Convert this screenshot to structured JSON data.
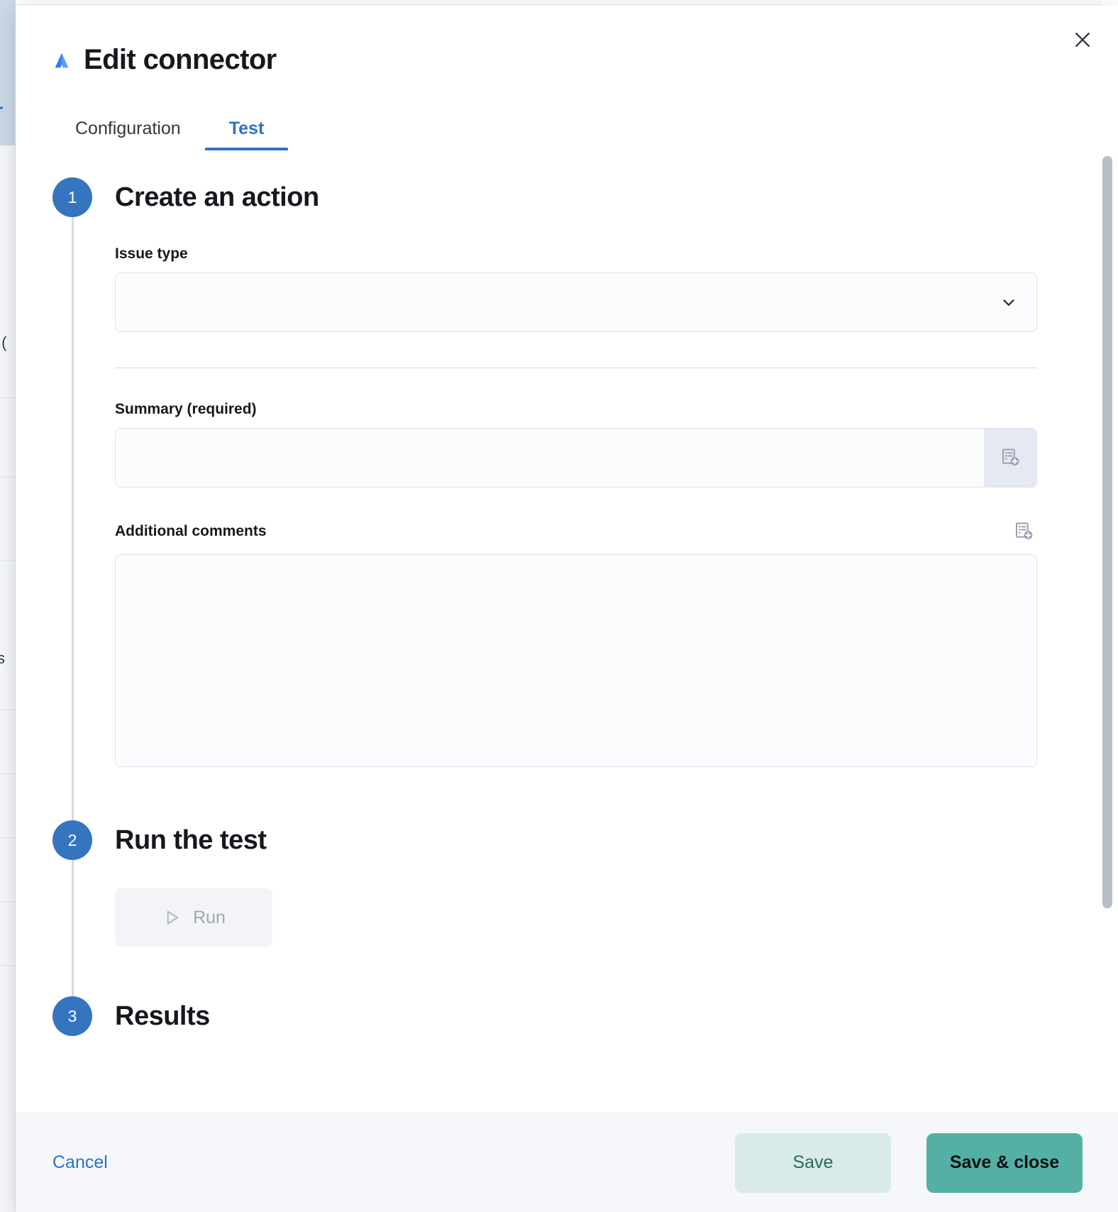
{
  "modal": {
    "title": "Edit connector",
    "brand_icon": "atlassian-jira-logo-icon",
    "close_icon": "close-icon",
    "accent_color": "#2e72c4",
    "tabs": [
      {
        "label": "Configuration",
        "active": false
      },
      {
        "label": "Test",
        "active": true
      }
    ]
  },
  "steps": [
    {
      "number": "1",
      "title": "Create an action"
    },
    {
      "number": "2",
      "title": "Run the test"
    },
    {
      "number": "3",
      "title": "Results"
    }
  ],
  "form": {
    "issue_type": {
      "label": "Issue type",
      "value": "",
      "placeholder": "",
      "chevron_icon": "chevron-down-icon"
    },
    "summary": {
      "label": "Summary (required)",
      "value": "",
      "placeholder": "",
      "append_icon": "add-variable-icon"
    },
    "additional_comments": {
      "label": "Additional comments",
      "value": "",
      "placeholder": "",
      "append_icon": "add-variable-icon"
    }
  },
  "run": {
    "label": "Run",
    "icon": "play-triangle-icon",
    "disabled": true
  },
  "footer": {
    "cancel_label": "Cancel",
    "save_label": "Save",
    "save_close_label": "Save & close",
    "save_color": "#d8ebe8",
    "save_close_color": "#54b0a5"
  }
}
